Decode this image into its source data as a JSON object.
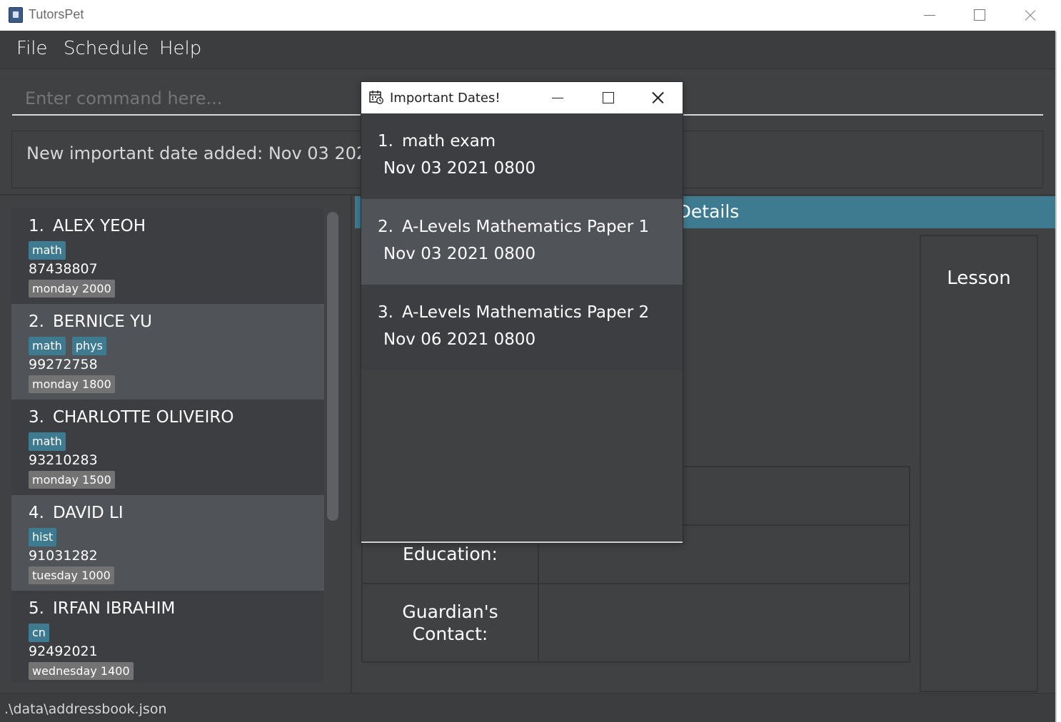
{
  "window": {
    "title": "TutorsPet"
  },
  "menu": {
    "file": "File",
    "schedule": "Schedule",
    "help": "Help"
  },
  "command": {
    "placeholder": "Enter command here..."
  },
  "result": {
    "message": "New important date added: Nov 03 2021 08"
  },
  "students": [
    {
      "index": "1.",
      "name": "ALEX YEOH",
      "tags": [
        "math"
      ],
      "phone": "87438807",
      "lesson": "monday 2000"
    },
    {
      "index": "2.",
      "name": "BERNICE YU",
      "tags": [
        "math",
        "phys"
      ],
      "phone": "99272758",
      "lesson": "monday 1800"
    },
    {
      "index": "3.",
      "name": "CHARLOTTE OLIVEIRO",
      "tags": [
        "math"
      ],
      "phone": "93210283",
      "lesson": "monday 1500"
    },
    {
      "index": "4.",
      "name": "DAVID LI",
      "tags": [
        "hist"
      ],
      "phone": "91031282",
      "lesson": "tuesday 1000"
    },
    {
      "index": "5.",
      "name": "IRFAN IBRAHIM",
      "tags": [
        "cn"
      ],
      "phone": "92492021",
      "lesson": "wednesday 1400"
    }
  ],
  "details": {
    "header": "Details",
    "lesson_column": "Lesson",
    "education_label": "Education:",
    "guardian_label": "Guardian's Contact:"
  },
  "popup": {
    "title": "Important Dates!",
    "dates": [
      {
        "index": "1.",
        "description": "math exam",
        "datetime": "Nov 03 2021 0800"
      },
      {
        "index": "2.",
        "description": "A-Levels Mathematics Paper 1",
        "datetime": "Nov 03 2021 0800"
      },
      {
        "index": "3.",
        "description": "A-Levels Mathematics Paper 2",
        "datetime": "Nov 06 2021 0800"
      }
    ]
  },
  "status": {
    "path": ".\\data\\addressbook.json"
  },
  "colors": {
    "background": "#3f4143",
    "accent": "#3e7b91",
    "lesson_tag": "#737373",
    "selected_row": "#505458"
  }
}
